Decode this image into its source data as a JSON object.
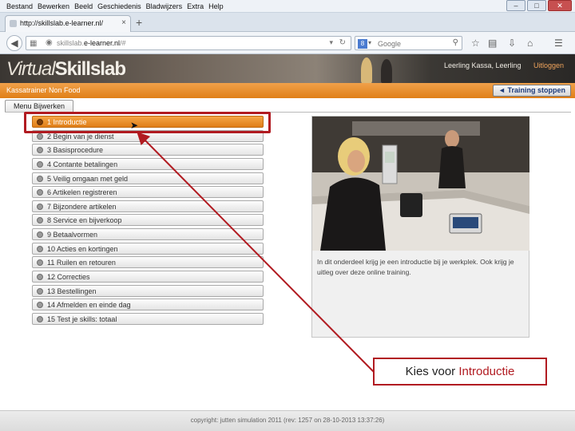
{
  "browser": {
    "menu": [
      "Bestand",
      "Bewerken",
      "Beeld",
      "Geschiedenis",
      "Bladwijzers",
      "Extra",
      "Help"
    ],
    "window_controls": {
      "minimize": "–",
      "maximize": "□",
      "close": "✕"
    },
    "tab": {
      "title": "http://skillslab.e-learner.nl/",
      "close": "×"
    },
    "new_tab": "+",
    "url": {
      "prefix": "skillslab.",
      "domain": "e-learner.nl",
      "suffix": "/#"
    },
    "search": {
      "placeholder": "Google"
    }
  },
  "site": {
    "logo_virtual": "Virtual",
    "logo_skillslab": "Skillslab",
    "user": "Leerling Kassa, Leerling",
    "logout": "Uitloggen",
    "course_title": "Kassatrainer Non Food",
    "stop_training": "◄  Training stoppen",
    "menu_button": "Menu Bijwerken"
  },
  "chapters": [
    {
      "label": "1 Introductie",
      "active": true
    },
    {
      "label": "2 Begin van je dienst",
      "active": false
    },
    {
      "label": "3 Basisprocedure",
      "active": false
    },
    {
      "label": "4 Contante betalingen",
      "active": false
    },
    {
      "label": "5 Veilig omgaan met geld",
      "active": false
    },
    {
      "label": "6 Artikelen registreren",
      "active": false
    },
    {
      "label": "7 Bijzondere artikelen",
      "active": false
    },
    {
      "label": "8 Service en bijverkoop",
      "active": false
    },
    {
      "label": "9 Betaalvormen",
      "active": false
    },
    {
      "label": "10 Acties en kortingen",
      "active": false
    },
    {
      "label": "11 Ruilen en retouren",
      "active": false
    },
    {
      "label": "12 Correcties",
      "active": false
    },
    {
      "label": "13 Bestellingen",
      "active": false
    },
    {
      "label": "14 Afmelden en einde dag",
      "active": false
    },
    {
      "label": "15 Test je skills: totaal",
      "active": false
    }
  ],
  "preview": {
    "description": "In dit onderdeel krijg je een introductie bij je werkplek. Ook krijg je uitleg over deze online training."
  },
  "callout": {
    "prefix": "Kies voor ",
    "highlight": "Introductie"
  },
  "footer": "copyright: jutten simulation 2011 (rev: 1257 on 28-10-2013 13:37:26)",
  "colors": {
    "accent_orange": "#e8891f",
    "annotation_red": "#b11b21",
    "stop_text": "#1d3b7a"
  },
  "icons": [
    "back-arrow-icon",
    "page-icon",
    "globe-icon",
    "dropdown-icon",
    "reload-icon",
    "google-icon",
    "magnifier-icon",
    "star-icon",
    "clipboard-icon",
    "download-icon",
    "home-icon",
    "hamburger-icon",
    "mouse-pointer-icon"
  ]
}
